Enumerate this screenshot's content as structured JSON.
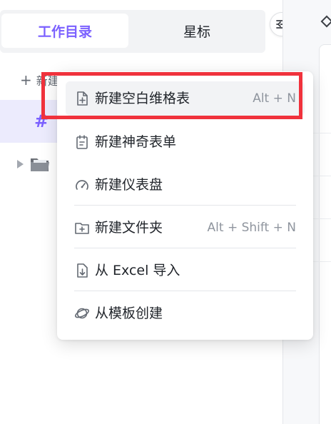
{
  "tabs": [
    {
      "label": "工作目录",
      "active": true
    },
    {
      "label": "星标",
      "active": false
    }
  ],
  "sidebar": {
    "new_label": "新建",
    "selected_icon": "#"
  },
  "menu": {
    "items": [
      {
        "label": "新建空白维格表",
        "shortcut": "Alt + N",
        "icon": "new-sheet-icon",
        "highlighted": true
      },
      {
        "label": "新建神奇表单",
        "shortcut": "",
        "icon": "form-icon"
      },
      {
        "label": "新建仪表盘",
        "shortcut": "",
        "icon": "dashboard-icon"
      },
      {
        "label": "新建文件夹",
        "shortcut": "Alt + Shift + N",
        "icon": "new-folder-icon"
      },
      {
        "label": "从 Excel 导入",
        "shortcut": "",
        "icon": "import-icon"
      },
      {
        "label": "从模板创建",
        "shortcut": "",
        "icon": "template-icon"
      }
    ]
  },
  "colors": {
    "accent": "#7b61ff",
    "highlight": "#f0323c"
  }
}
